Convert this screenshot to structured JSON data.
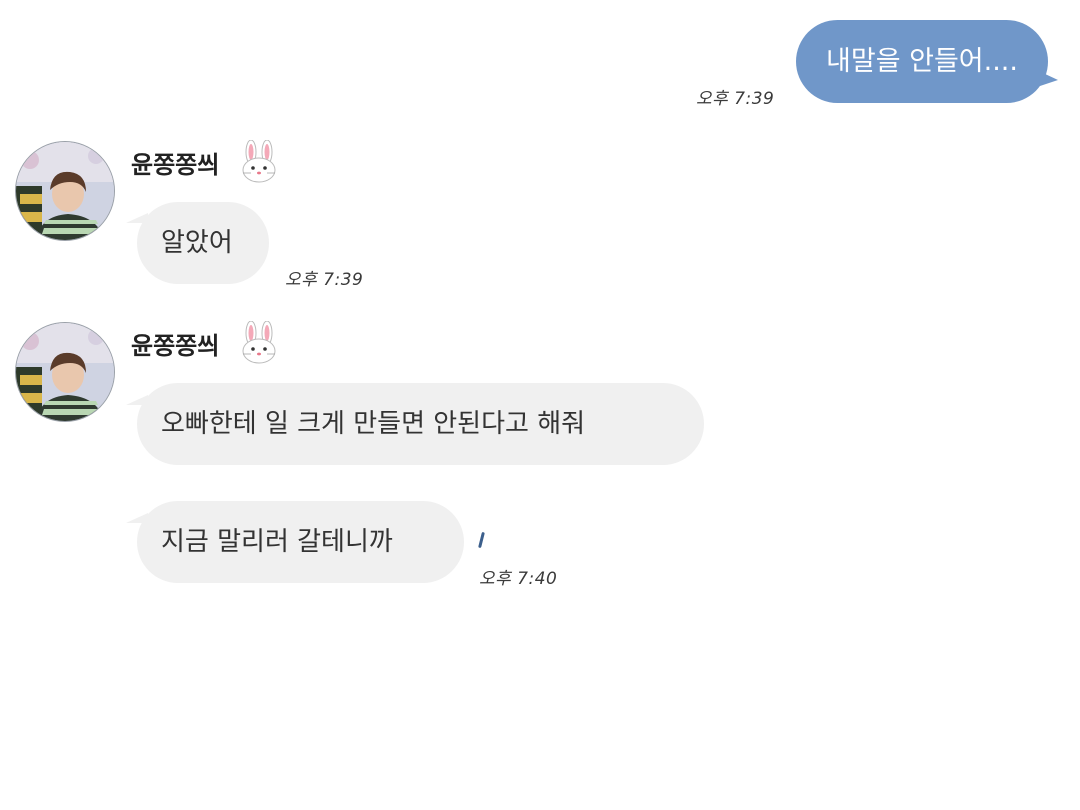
{
  "outgoing": {
    "text": "내말을 안들어....",
    "time": "오후 7:39",
    "bubble_color": "#7097c9"
  },
  "groups": [
    {
      "sender": {
        "name": "윤쫑쫑씌",
        "emoji": "rabbit-face-icon",
        "avatar": "profile-photo"
      },
      "messages": [
        {
          "text": "알았어"
        }
      ],
      "time": "오후 7:39"
    },
    {
      "sender": {
        "name": "윤쫑쫑씌",
        "emoji": "rabbit-face-icon",
        "avatar": "profile-photo"
      },
      "messages": [
        {
          "text": "오빠한테 일 크게 만들면 안된다고 해줘"
        },
        {
          "text": "지금 말리러 갈테니까"
        }
      ],
      "time": "오후 7:40"
    }
  ],
  "colors": {
    "incoming_bubble": "#f0f0f0",
    "outgoing_bubble": "#7097c9",
    "background": "#ffffff"
  }
}
